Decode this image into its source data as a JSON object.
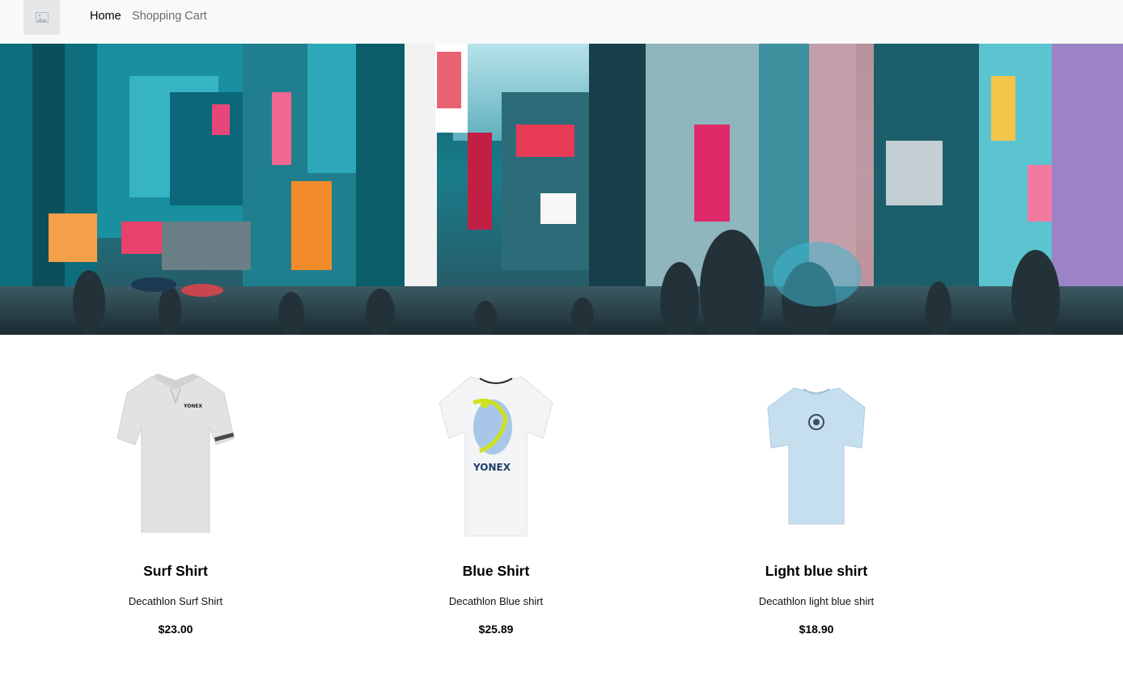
{
  "nav": {
    "logo_icon": "image-placeholder-icon",
    "links": [
      {
        "label": "Home"
      },
      {
        "label": "Shopping Cart"
      }
    ]
  },
  "hero": {
    "image_alt": "city-street-banner"
  },
  "products": [
    {
      "title": "Surf Shirt",
      "description": "Decathlon Surf Shirt",
      "price": "$23.00",
      "color": "#e6e6e6",
      "logo_text": "YONEX"
    },
    {
      "title": "Blue Shirt",
      "description": "Decathlon Blue shirt",
      "price": "$25.89",
      "color": "#f3f5f8",
      "logo_text": "YONEX"
    },
    {
      "title": "Light blue shirt",
      "description": "Decathlon light blue shirt",
      "price": "$18.90",
      "color": "#c9dfee",
      "logo_text": ""
    }
  ]
}
